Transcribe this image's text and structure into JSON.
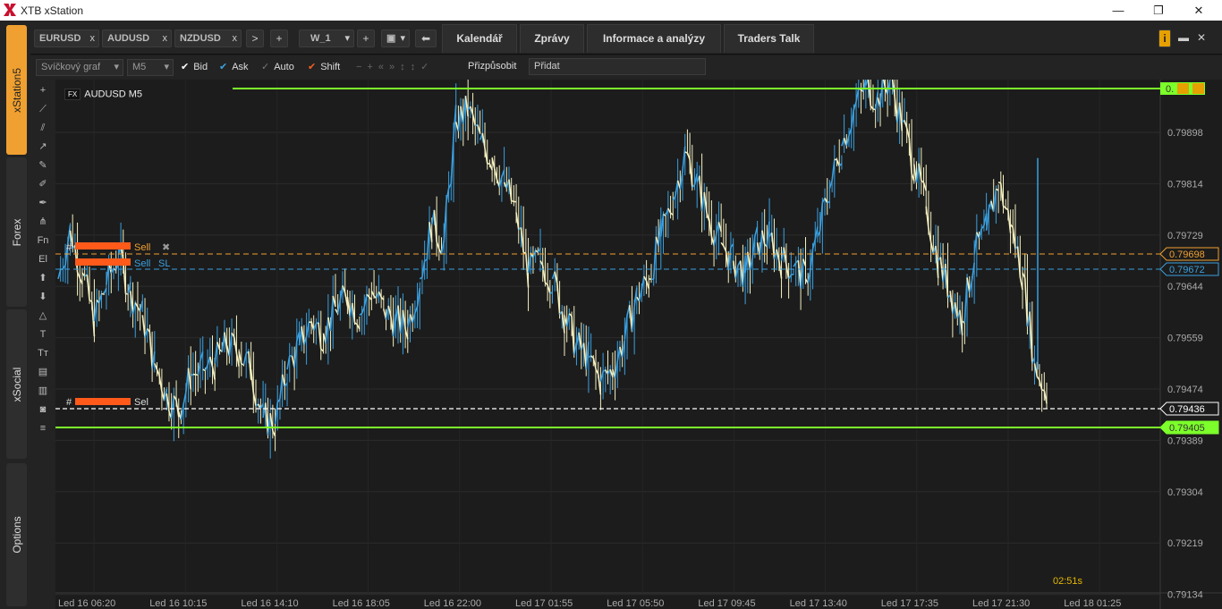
{
  "window": {
    "title": "XTB xStation",
    "minimize": "—",
    "maximize": "❐",
    "close": "✕"
  },
  "sidebar": {
    "tabs": [
      {
        "label": "xStation5"
      },
      {
        "label": "Forex"
      },
      {
        "label": "xSocial"
      },
      {
        "label": "Options"
      }
    ]
  },
  "symbol_tabs": [
    {
      "label": "EURUSD",
      "close": "x"
    },
    {
      "label": "AUDUSD",
      "close": "x"
    },
    {
      "label": "NZDUSD",
      "close": "x"
    }
  ],
  "tabbar": {
    "next": ">",
    "add": "+",
    "workspace": "W_1",
    "workspace_add": "+",
    "back": "⬅",
    "info": "i",
    "min": "▬",
    "close": "✕"
  },
  "nav_tabs": [
    "Kalendář",
    "Zprávy",
    "Informace a analýzy",
    "Traders Talk"
  ],
  "toolbar": {
    "chart_type": "Svíčkový graf",
    "timeframe": "M5",
    "bid": "Bid",
    "ask": "Ask",
    "auto": "Auto",
    "shift": "Shift",
    "customize": "Přizpůsobit",
    "add_placeholder": "Přidat"
  },
  "chart": {
    "symbol_badge": "FX",
    "symbol": "AUDUSD M5",
    "timer": "02:51s",
    "y_axis": [
      "0.79898",
      "0.79814",
      "0.79729",
      "0.79644",
      "0.79559",
      "0.79474",
      "0.79389",
      "0.79304",
      "0.79219",
      "0.79134"
    ],
    "x_axis": [
      "Led 16 06:20",
      "Led 16 10:15",
      "Led 16 14:10",
      "Led 16 18:05",
      "Led 16 22:00",
      "Led 17 01:55",
      "Led 17 05:50",
      "Led 17 09:45",
      "Led 17 13:40",
      "Led 17 17:35",
      "Led 17 21:30",
      "Led 18 01:25"
    ],
    "price_tags": {
      "top_green": "0.",
      "orange": "0.79698",
      "blue": "0.79672",
      "white": "0.79436",
      "bottom_green": "0.79405"
    },
    "orders": {
      "order1": "Sell",
      "order2_a": "Sell",
      "order2_b": "SL",
      "order3": "Sel",
      "hash": "#"
    },
    "colors": {
      "green": "#7cff2a",
      "orange": "#f0a030",
      "blue": "#3aa0e0",
      "up": "#3aa0e0",
      "down": "#f4f0c0"
    }
  },
  "chart_data": {
    "type": "line",
    "title": "AUDUSD M5",
    "x_ticks": [
      "Led 16 06:20",
      "Led 16 10:15",
      "Led 16 14:10",
      "Led 16 18:05",
      "Led 16 22:00",
      "Led 17 01:55",
      "Led 17 05:50",
      "Led 17 09:45",
      "Led 17 13:40",
      "Led 17 17:35",
      "Led 17 21:30",
      "Led 18 01:25"
    ],
    "ylim": [
      0.7911,
      0.7996
    ],
    "series": [
      {
        "values": [
          0.7963,
          0.7971,
          0.7964,
          0.7956,
          0.7962,
          0.7967,
          0.7961,
          0.7957,
          0.7949,
          0.7944,
          0.7941,
          0.7947,
          0.7948,
          0.7949,
          0.7952,
          0.7951,
          0.7948,
          0.794,
          0.7939,
          0.7948,
          0.7952,
          0.7956,
          0.7954,
          0.7958,
          0.796,
          0.7957,
          0.7961,
          0.7958,
          0.7956,
          0.7955,
          0.7963,
          0.7972,
          0.7969,
          0.7989,
          0.7991,
          0.7986,
          0.7983,
          0.7979,
          0.7974,
          0.7964,
          0.7966,
          0.7963,
          0.7957,
          0.7952,
          0.795,
          0.7946,
          0.7948,
          0.7953,
          0.796,
          0.7963,
          0.797,
          0.7976,
          0.7984,
          0.7979,
          0.7973,
          0.7969,
          0.7966,
          0.7964,
          0.7969,
          0.797,
          0.7966,
          0.7965,
          0.7963,
          0.797,
          0.7978,
          0.7985,
          0.7991,
          0.7995,
          0.7993,
          0.7996,
          0.7989,
          0.7982,
          0.7975,
          0.7966,
          0.7961,
          0.7956,
          0.7967,
          0.7971,
          0.7979,
          0.7972,
          0.7964,
          0.7949,
          0.7944
        ]
      }
    ]
  }
}
